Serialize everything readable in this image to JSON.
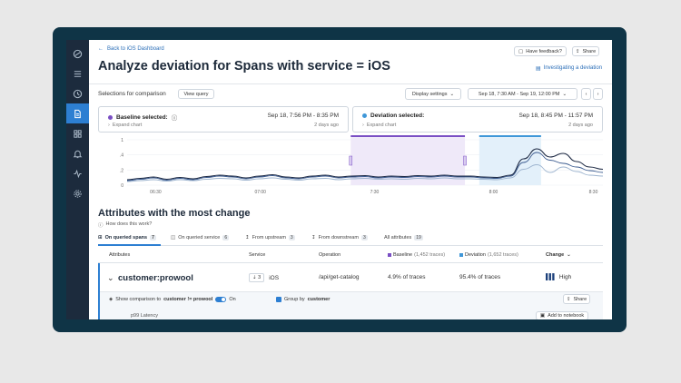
{
  "nav": {
    "back": "Back to iOS Dashboard",
    "title": "Analyze deviation for Spans with service = iOS",
    "feedback": "Have feedback?",
    "share": "Share",
    "investigating": "Investigating a deviation"
  },
  "toolbar": {
    "selections_label": "Selections for comparison",
    "view_query": "View query",
    "display_settings": "Display settings",
    "time_range": "Sep 18, 7:30 AM - Sep 19, 12:00 PM"
  },
  "baseline": {
    "label": "Baseline selected:",
    "time": "Sep 18, 7:56 PM - 8:35 PM",
    "expand": "Expand chart",
    "ago": "2 days ago",
    "color": "#7a4fc4"
  },
  "deviation": {
    "label": "Deviation selected:",
    "time": "Sep 18, 8:45 PM - 11:57 PM",
    "expand": "Expand chart",
    "ago": "2 days ago",
    "color": "#3f97d8"
  },
  "chart_data": {
    "type": "line",
    "y_ticks": [
      "1",
      ".4",
      ".2",
      "0"
    ],
    "x_ticks": [
      "06:30",
      "07:00",
      "7:30",
      "8:00",
      "8:30"
    ],
    "series": [
      {
        "values": [
          0.12,
          0.15,
          0.18,
          0.13,
          0.17,
          0.14,
          0.19,
          0.22,
          0.2,
          0.16,
          0.2,
          0.23,
          0.18,
          0.16,
          0.2,
          0.22,
          0.18,
          0.2,
          0.21,
          0.18,
          0.2,
          0.19,
          0.21,
          0.2,
          0.22,
          0.2,
          0.2,
          0.18,
          0.17,
          0.22,
          0.58,
          0.8,
          0.62,
          0.7,
          0.52,
          0.4,
          0.35
        ]
      },
      {
        "values": [
          0.1,
          0.13,
          0.16,
          0.11,
          0.15,
          0.12,
          0.17,
          0.2,
          0.18,
          0.14,
          0.18,
          0.21,
          0.16,
          0.14,
          0.18,
          0.2,
          0.16,
          0.18,
          0.19,
          0.16,
          0.18,
          0.17,
          0.19,
          0.18,
          0.2,
          0.18,
          0.18,
          0.16,
          0.15,
          0.2,
          0.5,
          0.72,
          0.55,
          0.48,
          0.4,
          0.32,
          0.28
        ]
      },
      {
        "values": [
          0.08,
          0.1,
          0.12,
          0.09,
          0.12,
          0.1,
          0.13,
          0.15,
          0.14,
          0.11,
          0.14,
          0.16,
          0.13,
          0.11,
          0.14,
          0.15,
          0.12,
          0.14,
          0.15,
          0.13,
          0.14,
          0.13,
          0.15,
          0.14,
          0.16,
          0.14,
          0.14,
          0.13,
          0.12,
          0.16,
          0.35,
          0.45,
          0.28,
          0.4,
          0.3,
          0.22,
          0.2
        ]
      }
    ],
    "baseline_range": [
      0.47,
      0.71
    ],
    "deviation_range": [
      0.74,
      0.87
    ]
  },
  "attributes": {
    "heading": "Attributes with the most change",
    "how": "How does this work?",
    "tabs": [
      {
        "label": "On queried spans",
        "count": "7"
      },
      {
        "label": "On queried service",
        "count": "6"
      },
      {
        "label": "From upstream",
        "count": "3"
      },
      {
        "label": "From downstream",
        "count": "3"
      },
      {
        "label": "All attributes",
        "count": "19"
      }
    ],
    "columns": {
      "attributes": "Attributes",
      "service": "Service",
      "operation": "Operation",
      "baseline": "Baseline",
      "baseline_count": "(1,452 traces)",
      "deviation": "Deviation",
      "deviation_count": "(1,652 traces)",
      "change": "Change"
    },
    "row": {
      "name": "customer:prowool",
      "service_count": "3",
      "service": "iOS",
      "operation": "/api/get-catalog",
      "baseline": "4.9% of traces",
      "deviation": "95.4% of traces",
      "change": "High"
    },
    "subrow": {
      "show_prefix": "Show comparison to",
      "show_target": "customer != prowool",
      "toggle": "On",
      "group_prefix": "Group by",
      "group_target": "customer",
      "share": "Share",
      "latency": "p99 Latency",
      "add_notebook": "Add to notebook"
    }
  }
}
